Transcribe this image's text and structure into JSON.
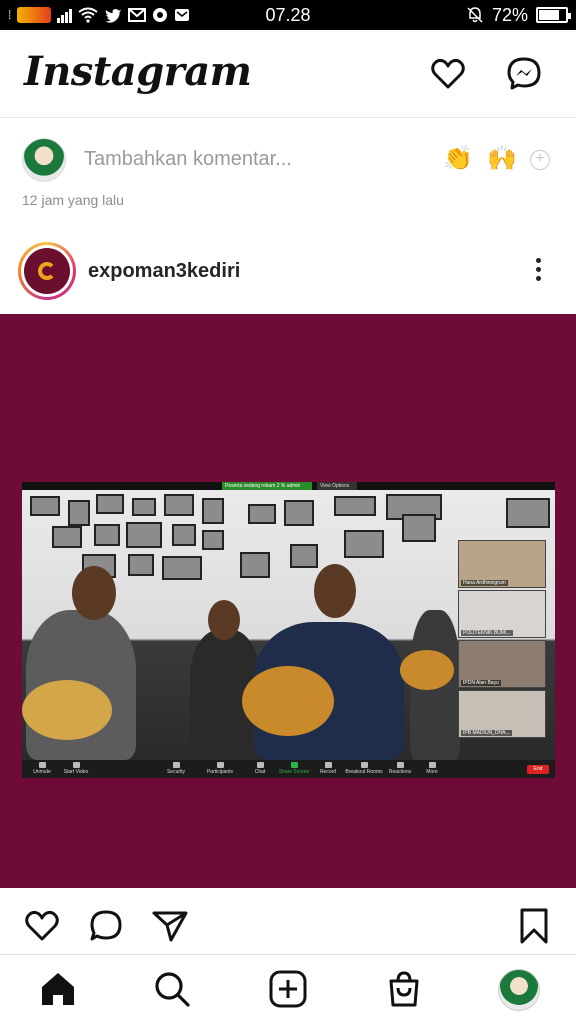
{
  "status_bar": {
    "time": "07.28",
    "battery_text": "72%",
    "battery_level": 0.72
  },
  "header": {
    "app_title": "Instagram",
    "icons": [
      "heart-icon",
      "messenger-icon"
    ]
  },
  "comment": {
    "placeholder": "Tambahkan komentar...",
    "quick_emojis": [
      "👏",
      "🙌"
    ],
    "timestamp": "12 jam yang lalu"
  },
  "post": {
    "username": "expoman3kediri",
    "zoom": {
      "recording_banner": "Peserta sedang rekam 2 % admin",
      "view_options": "View Options",
      "participants": [
        {
          "name": "Hana Ardhiningrum"
        },
        {
          "name": "POLITEKNIK BUMI..."
        },
        {
          "name": "IPDN Alan Bayu"
        },
        {
          "name": "IPB MADIUN_DHA..."
        }
      ],
      "toolbar": [
        "Unmute",
        "Start Video",
        "Security",
        "Participants",
        "Chat",
        "Share Screen",
        "Record",
        "Breakout Rooms",
        "Reactions",
        "More"
      ],
      "participant_count": "106",
      "end_label": "End"
    }
  },
  "actions": [
    "like-icon",
    "comment-icon",
    "share-icon",
    "save-icon"
  ],
  "nav": [
    "home-icon",
    "search-icon",
    "create-icon",
    "shop-icon",
    "profile-avatar"
  ],
  "colors": {
    "post_background": "#6e0b36",
    "text_primary": "#262626",
    "text_secondary": "#8e8e8e"
  }
}
